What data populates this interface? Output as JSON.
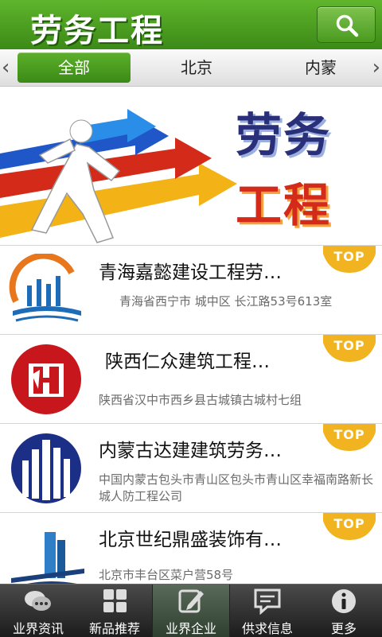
{
  "header": {
    "title": "劳务工程"
  },
  "tabs": {
    "left_arrow": "‹",
    "right_arrow": "›",
    "items": [
      "全部",
      "北京",
      "内蒙"
    ],
    "active": 0
  },
  "banner": {
    "line1": "劳务",
    "line2": "工程"
  },
  "companies": [
    {
      "name": "青海嘉懿建设工程劳…",
      "address": "青海省西宁市 城中区 长江路53号613室",
      "badge": "TOP"
    },
    {
      "name": "陕西仁众建筑工程…",
      "address": "陕西省汉中市西乡县古城镇古城村七组",
      "badge": "TOP"
    },
    {
      "name": "内蒙古达建建筑劳务…",
      "address": "中国内蒙古包头市青山区包头市青山区幸福南路新长城人防工程公司",
      "badge": "TOP"
    },
    {
      "name": "北京世纪鼎盛装饰有…",
      "address": "北京市丰台区菜户营58号",
      "badge": "TOP"
    }
  ],
  "nav": [
    {
      "label": "业界资讯",
      "icon": "chat-bubbles-icon"
    },
    {
      "label": "新品推荐",
      "icon": "grid-icon"
    },
    {
      "label": "业界企业",
      "icon": "edit-icon",
      "active": true
    },
    {
      "label": "供求信息",
      "icon": "message-icon"
    },
    {
      "label": "更多",
      "icon": "info-icon"
    }
  ]
}
